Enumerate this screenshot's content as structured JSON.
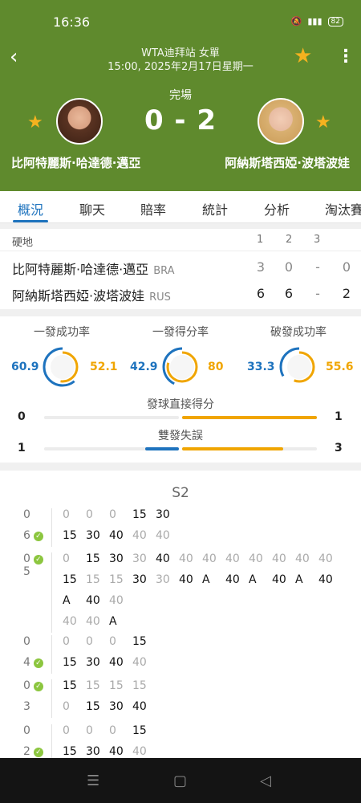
{
  "status_bar": {
    "time": "16:36",
    "battery": "82"
  },
  "header": {
    "tournament": "WTA迪拜站 女單",
    "datetime": "15:00, 2025年2月17日星期一",
    "match_status": "完場",
    "score": "0 - 2",
    "player1": {
      "name": "比阿特麗斯·哈達德·邁亞",
      "country": "BRA"
    },
    "player2": {
      "name": "阿納斯塔西婭·波塔波娃",
      "country": "RUS"
    },
    "accent_color": "#5f8a2d",
    "star_color": "#f5b21f"
  },
  "tabs": [
    "概況",
    "聊天",
    "賠率",
    "統計",
    "分析",
    "淘汰賽"
  ],
  "active_tab": "概況",
  "scoreboard": {
    "surface": "硬地",
    "set_labels": [
      "1",
      "2",
      "3"
    ],
    "rows": [
      {
        "name": "比阿特麗斯·哈達德·邁亞",
        "country": "BRA",
        "sets": [
          "3",
          "0",
          "-"
        ],
        "points": "0"
      },
      {
        "name": "阿納斯塔西婭·波塔波娃",
        "country": "RUS",
        "sets": [
          "6",
          "6",
          "-"
        ],
        "points": "2"
      }
    ]
  },
  "serve_stats": [
    {
      "title": "一發成功率",
      "p1": "60.9",
      "p2": "52.1"
    },
    {
      "title": "一發得分率",
      "p1": "42.9",
      "p2": "80"
    },
    {
      "title": "破發成功率",
      "p1": "33.3",
      "p2": "55.6"
    }
  ],
  "bar_stats": [
    {
      "title": "發球直接得分",
      "p1": "0",
      "p2": "1"
    },
    {
      "title": "雙發失誤",
      "p1": "1",
      "p2": "3"
    }
  ],
  "set_detail": {
    "set_label": "S2",
    "games": [
      {
        "top": "0",
        "bottom": "6",
        "check": "bottom",
        "rows": [
          [
            "0",
            "0",
            "0",
            "15",
            "30"
          ],
          [
            "15",
            "30",
            "40",
            "40",
            "40"
          ]
        ],
        "dark": [
          [
            false,
            false,
            false,
            true,
            true
          ],
          [
            true,
            true,
            true,
            false,
            false
          ]
        ]
      },
      {
        "top": "0",
        "bottom": "5",
        "check": "top",
        "rows": [
          [
            "0",
            "15",
            "30",
            "30",
            "40",
            "40",
            "40",
            "40",
            "40",
            "40",
            "40",
            "40"
          ],
          [
            "15",
            "15",
            "15",
            "30",
            "30",
            "40",
            "A",
            "40",
            "A",
            "40",
            "A",
            "40"
          ],
          [
            "A",
            "40",
            "40"
          ],
          [
            "40",
            "40",
            "A"
          ]
        ],
        "dark": [
          [
            false,
            true,
            true,
            false,
            true,
            false,
            false,
            false,
            false,
            false,
            false,
            false
          ],
          [
            true,
            false,
            false,
            true,
            false,
            true,
            true,
            true,
            true,
            true,
            true,
            true
          ],
          [
            true,
            true,
            false
          ],
          [
            false,
            false,
            true
          ]
        ]
      },
      {
        "top": "0",
        "bottom": "4",
        "check": "bottom",
        "rows": [
          [
            "0",
            "0",
            "0",
            "15"
          ],
          [
            "15",
            "30",
            "40",
            "40"
          ]
        ],
        "dark": [
          [
            false,
            false,
            false,
            true
          ],
          [
            true,
            true,
            true,
            false
          ]
        ]
      },
      {
        "top": "0",
        "bottom": "3",
        "check": "top",
        "rows": [
          [
            "15",
            "15",
            "15",
            "15"
          ],
          [
            "0",
            "15",
            "30",
            "40"
          ]
        ],
        "dark": [
          [
            true,
            false,
            false,
            false
          ],
          [
            false,
            true,
            true,
            true
          ]
        ]
      },
      {
        "top": "0",
        "bottom": "2",
        "check": "bottom",
        "rows": [
          [
            "0",
            "0",
            "0",
            "15"
          ],
          [
            "15",
            "30",
            "40",
            "40"
          ]
        ],
        "dark": [
          [
            false,
            false,
            false,
            true
          ],
          [
            true,
            true,
            true,
            false
          ]
        ]
      }
    ]
  }
}
